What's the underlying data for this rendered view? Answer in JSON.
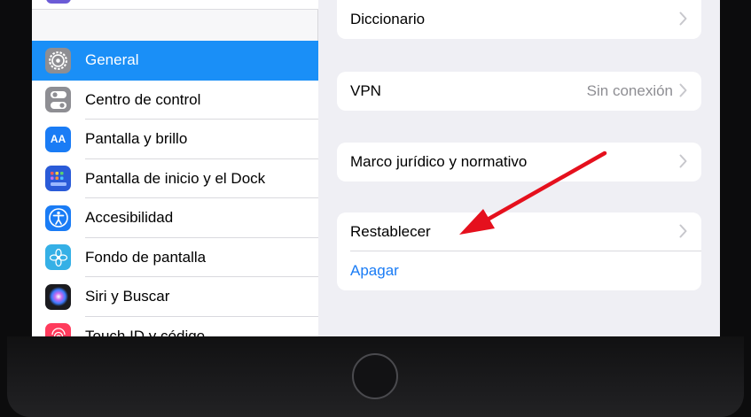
{
  "sidebar": {
    "items": [
      {
        "label": "General",
        "icon": "gear-icon",
        "selected": true
      },
      {
        "label": "Centro de control",
        "icon": "toggles-icon",
        "selected": false
      },
      {
        "label": "Pantalla y brillo",
        "icon": "display-brightness-icon",
        "icon_text": "AA",
        "selected": false
      },
      {
        "label": "Pantalla de inicio y el Dock",
        "icon": "home-screen-grid-icon",
        "selected": false
      },
      {
        "label": "Accesibilidad",
        "icon": "accessibility-icon",
        "selected": false
      },
      {
        "label": "Fondo de pantalla",
        "icon": "wallpaper-flower-icon",
        "selected": false
      },
      {
        "label": "Siri y Buscar",
        "icon": "siri-icon",
        "selected": false
      },
      {
        "label": "Touch ID y código",
        "icon": "fingerprint-icon",
        "selected": false
      }
    ]
  },
  "detail": {
    "groups": [
      {
        "rows": [
          {
            "label": "Diccionario",
            "value": "",
            "chevron": true
          }
        ]
      },
      {
        "rows": [
          {
            "label": "VPN",
            "value": "Sin conexión",
            "chevron": true
          }
        ]
      },
      {
        "rows": [
          {
            "label": "Marco jurídico y normativo",
            "value": "",
            "chevron": true
          }
        ]
      },
      {
        "rows": [
          {
            "label": "Restablecer",
            "value": "",
            "chevron": true
          },
          {
            "label": "Apagar",
            "value": "",
            "chevron": false,
            "link": true
          }
        ]
      }
    ]
  },
  "colors": {
    "accent": "#1a8ff7",
    "link": "#1a7cf5",
    "background": "#efeff4",
    "annotation_arrow": "#e5101d"
  }
}
